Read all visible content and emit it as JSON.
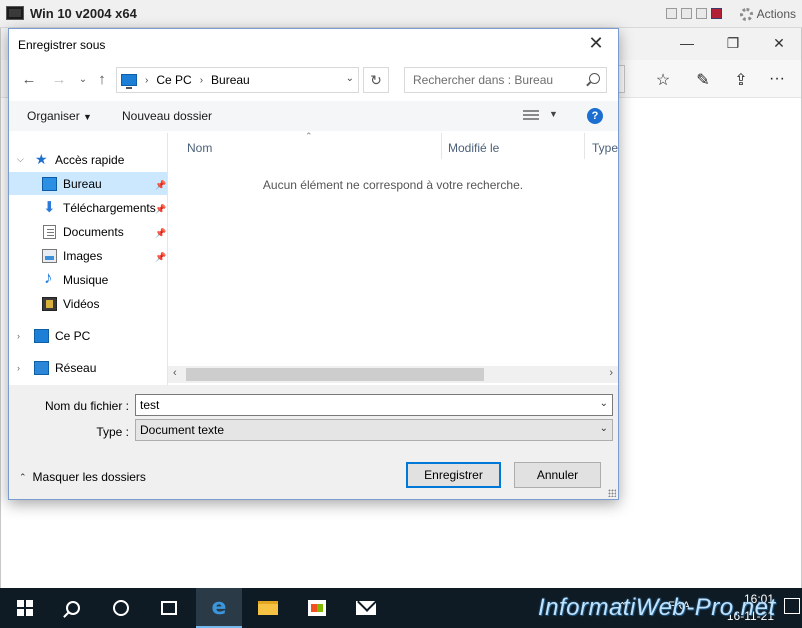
{
  "vm": {
    "title": "Win 10 v2004 x64",
    "actions_label": "Actions"
  },
  "background_app": {
    "minimize": "—",
    "maximize": "❐",
    "close": "✕"
  },
  "dialog": {
    "title": "Enregistrer sous",
    "close": "✕",
    "breadcrumb": [
      "Ce PC",
      "Bureau"
    ],
    "search_placeholder": "Rechercher dans : Bureau",
    "commands": {
      "organize": "Organiser",
      "new_folder": "Nouveau dossier",
      "help": "?"
    },
    "nav": {
      "quick_access": "Accès rapide",
      "items": [
        {
          "label": "Bureau",
          "icon": "desktop-icon",
          "pinned": true,
          "selected": true
        },
        {
          "label": "Téléchargements",
          "icon": "downloads-icon",
          "pinned": true
        },
        {
          "label": "Documents",
          "icon": "documents-icon",
          "pinned": true
        },
        {
          "label": "Images",
          "icon": "pictures-icon",
          "pinned": true
        },
        {
          "label": "Musique",
          "icon": "music-icon"
        },
        {
          "label": "Vidéos",
          "icon": "videos-icon"
        }
      ],
      "this_pc": "Ce PC",
      "network": "Réseau"
    },
    "columns": {
      "name": "Nom",
      "modified": "Modifié le",
      "type": "Type"
    },
    "empty_message": "Aucun élément ne correspond à votre recherche.",
    "form": {
      "filename_label": "Nom du fichier :",
      "filename_value": "test",
      "type_label": "Type :",
      "type_value": "Document texte"
    },
    "hide_folders": "Masquer les dossiers",
    "buttons": {
      "save": "Enregistrer",
      "cancel": "Annuler"
    }
  },
  "taskbar": {
    "tray_lang": "FRA",
    "time": "16:01",
    "date": "16-11-21"
  },
  "watermark": "InformatiWeb-Pro.net",
  "colors": {
    "selection": "#cce8ff",
    "accent": "#0078d7",
    "taskbar": "#0f1b24"
  }
}
